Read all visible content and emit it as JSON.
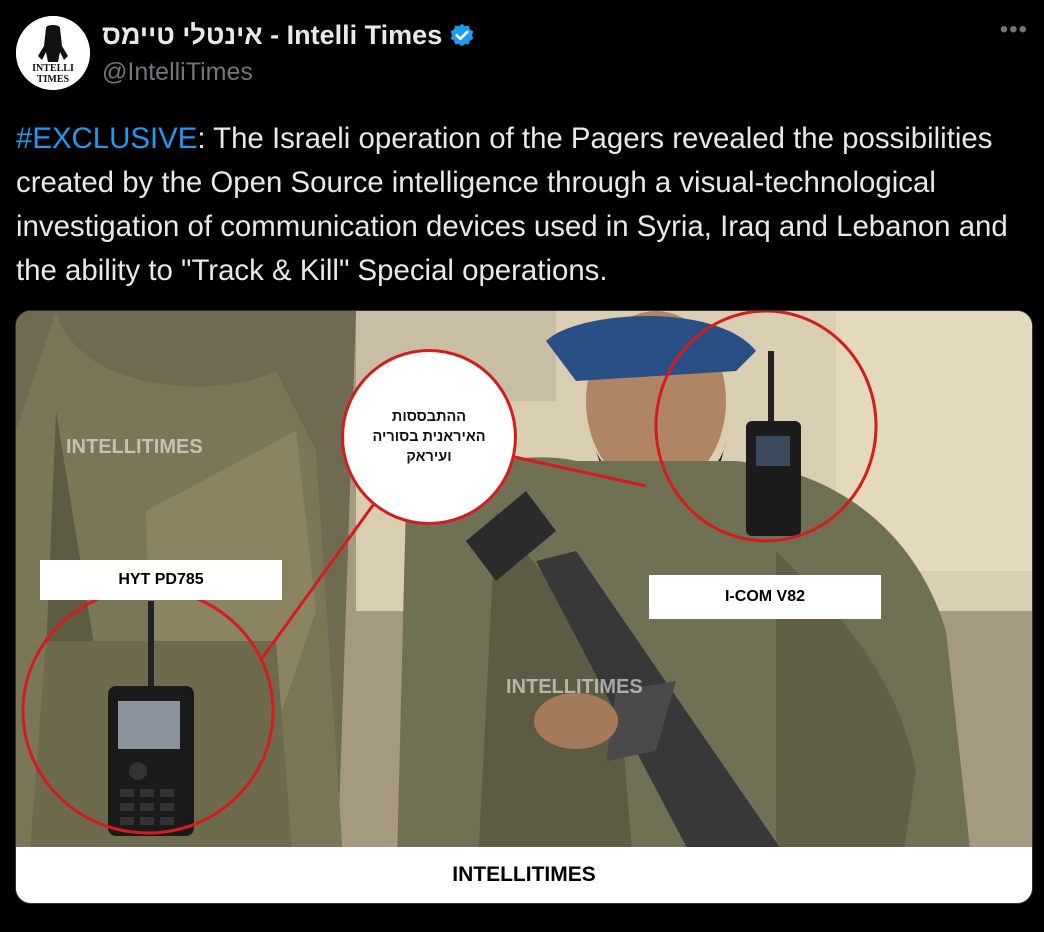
{
  "author": {
    "display_name": "אינטלי טיימס - Intelli Times",
    "handle": "@IntelliTimes",
    "avatar_text_line1": "INTELLI",
    "avatar_text_line2": "TIMES"
  },
  "more_label": "•••",
  "tweet": {
    "hashtag": "#EXCLUSIVE",
    "body": ": The Israeli operation of the Pagers revealed  the possibilities created by the Open Source intelligence through a visual-technological investigation of communication devices used in Syria, Iraq and Lebanon and the ability to \"Track & Kill\" Special operations."
  },
  "media": {
    "watermark_left": "INTELLITIMES",
    "watermark_center": "INTELLITIMES",
    "label_left": "HYT PD785",
    "label_right": "I-COM V82",
    "bubble_line1": "ההתבססות",
    "bubble_line2": "האיראנית בסוריה",
    "bubble_line3": "ועיראק",
    "caption": "INTELLITIMES"
  },
  "colors": {
    "accent": "#1d9bf0",
    "highlight_circle": "#d51c1c",
    "muted": "#71767b"
  }
}
